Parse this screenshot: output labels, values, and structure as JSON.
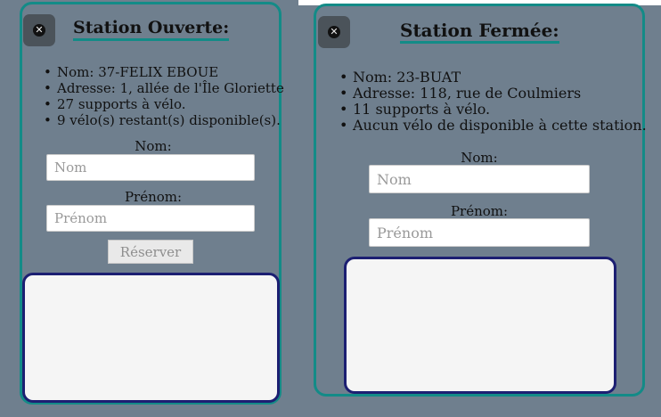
{
  "panels": [
    {
      "title": "Station Ouverte:",
      "close_icon": "close-circle-icon",
      "info": [
        "Nom: 37-FELIX EBOUE",
        "Adresse: 1, allée de l'Île Gloriette",
        "27 supports à vélo.",
        "9 vélo(s) restant(s) disponible(s)."
      ],
      "nom_label": "Nom:",
      "nom_placeholder": "Nom",
      "prenom_label": "Prénom:",
      "prenom_placeholder": "Prénom",
      "reserve_label": "Réserver"
    },
    {
      "title": "Station Fermée:",
      "close_icon": "close-circle-icon",
      "info": [
        "Nom: 23-BUAT",
        "Adresse: 118, rue de Coulmiers",
        "11 supports à vélo.",
        "Aucun vélo de disponible à cette station."
      ],
      "nom_label": "Nom:",
      "nom_placeholder": "Nom",
      "prenom_label": "Prénom:",
      "prenom_placeholder": "Prénom"
    }
  ],
  "colors": {
    "background": "#6f7f8e",
    "panel_border": "#138b87",
    "canvas_border": "#1c1f72",
    "canvas_fill": "#f5f5f5"
  }
}
